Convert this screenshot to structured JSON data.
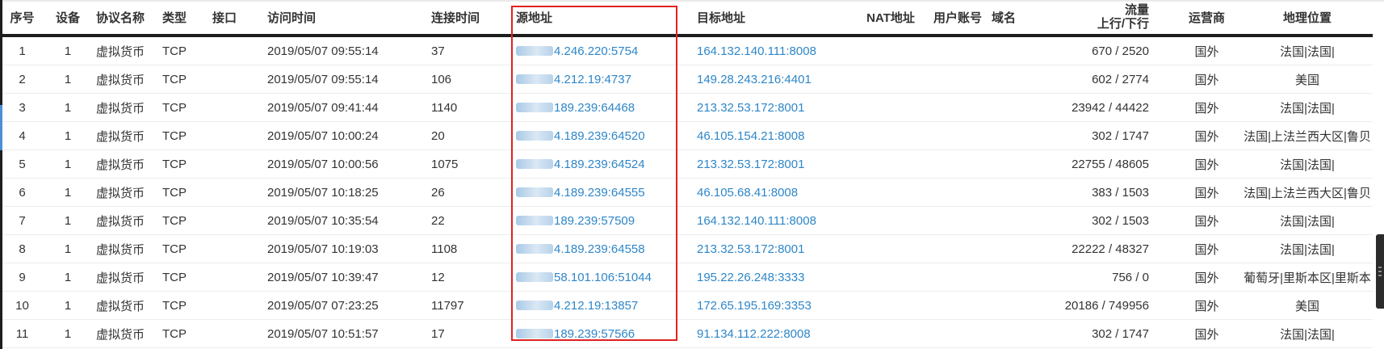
{
  "headers": {
    "seq": "序号",
    "device": "设备",
    "protocol": "协议名称",
    "type": "类型",
    "iface": "接口",
    "time": "访问时间",
    "duration": "连接时间",
    "src": "源地址",
    "dst": "目标地址",
    "nat": "NAT地址",
    "user": "用户账号",
    "domain": "域名",
    "flow_top": "流量",
    "flow_bottom": "上行/下行",
    "carrier": "运营商",
    "geo": "地理位置"
  },
  "rows": [
    {
      "seq": "1",
      "device": "1",
      "protocol": "虚拟货币",
      "type": "TCP",
      "iface": "",
      "time": "2019/05/07 09:55:14",
      "duration": "37",
      "src": "4.246.220:5754",
      "dst": "164.132.140.111:8008",
      "nat": "",
      "user": "",
      "domain": "",
      "flow": "670 / 2520",
      "carrier": "国外",
      "geo": "法国|法国|"
    },
    {
      "seq": "2",
      "device": "1",
      "protocol": "虚拟货币",
      "type": "TCP",
      "iface": "",
      "time": "2019/05/07 09:55:14",
      "duration": "106",
      "src": "4.212.19:4737",
      "dst": "149.28.243.216:4401",
      "nat": "",
      "user": "",
      "domain": "",
      "flow": "602 / 2774",
      "carrier": "国外",
      "geo": "美国"
    },
    {
      "seq": "3",
      "device": "1",
      "protocol": "虚拟货币",
      "type": "TCP",
      "iface": "",
      "time": "2019/05/07 09:41:44",
      "duration": "1140",
      "src": "189.239:64468",
      "dst": "213.32.53.172:8001",
      "nat": "",
      "user": "",
      "domain": "",
      "flow": "23942 / 44422",
      "carrier": "国外",
      "geo": "法国|法国|"
    },
    {
      "seq": "4",
      "device": "1",
      "protocol": "虚拟货币",
      "type": "TCP",
      "iface": "",
      "time": "2019/05/07 10:00:24",
      "duration": "20",
      "src": "4.189.239:64520",
      "dst": "46.105.154.21:8008",
      "nat": "",
      "user": "",
      "domain": "",
      "flow": "302 / 1747",
      "carrier": "国外",
      "geo": "法国|上法兰西大区|鲁贝"
    },
    {
      "seq": "5",
      "device": "1",
      "protocol": "虚拟货币",
      "type": "TCP",
      "iface": "",
      "time": "2019/05/07 10:00:56",
      "duration": "1075",
      "src": "4.189.239:64524",
      "dst": "213.32.53.172:8001",
      "nat": "",
      "user": "",
      "domain": "",
      "flow": "22755 / 48605",
      "carrier": "国外",
      "geo": "法国|法国|"
    },
    {
      "seq": "6",
      "device": "1",
      "protocol": "虚拟货币",
      "type": "TCP",
      "iface": "",
      "time": "2019/05/07 10:18:25",
      "duration": "26",
      "src": "4.189.239:64555",
      "dst": "46.105.68.41:8008",
      "nat": "",
      "user": "",
      "domain": "",
      "flow": "383 / 1503",
      "carrier": "国外",
      "geo": "法国|上法兰西大区|鲁贝"
    },
    {
      "seq": "7",
      "device": "1",
      "protocol": "虚拟货币",
      "type": "TCP",
      "iface": "",
      "time": "2019/05/07 10:35:54",
      "duration": "22",
      "src": "189.239:57509",
      "dst": "164.132.140.111:8008",
      "nat": "",
      "user": "",
      "domain": "",
      "flow": "302 / 1503",
      "carrier": "国外",
      "geo": "法国|法国|"
    },
    {
      "seq": "8",
      "device": "1",
      "protocol": "虚拟货币",
      "type": "TCP",
      "iface": "",
      "time": "2019/05/07 10:19:03",
      "duration": "1108",
      "src": "4.189.239:64558",
      "dst": "213.32.53.172:8001",
      "nat": "",
      "user": "",
      "domain": "",
      "flow": "22222 / 48327",
      "carrier": "国外",
      "geo": "法国|法国|"
    },
    {
      "seq": "9",
      "device": "1",
      "protocol": "虚拟货币",
      "type": "TCP",
      "iface": "",
      "time": "2019/05/07 10:39:47",
      "duration": "12",
      "src": "58.101.106:51044",
      "dst": "195.22.26.248:3333",
      "nat": "",
      "user": "",
      "domain": "",
      "flow": "756 / 0",
      "carrier": "国外",
      "geo": "葡萄牙|里斯本区|里斯本"
    },
    {
      "seq": "10",
      "device": "1",
      "protocol": "虚拟货币",
      "type": "TCP",
      "iface": "",
      "time": "2019/05/07 07:23:25",
      "duration": "11797",
      "src": "4.212.19:13857",
      "dst": "172.65.195.169:3353",
      "nat": "",
      "user": "",
      "domain": "",
      "flow": "20186 / 749956",
      "carrier": "国外",
      "geo": "美国"
    },
    {
      "seq": "11",
      "device": "1",
      "protocol": "虚拟货币",
      "type": "TCP",
      "iface": "",
      "time": "2019/05/07 10:51:57",
      "duration": "17",
      "src": "189.239:57566",
      "dst": "91.134.112.222:8008",
      "nat": "",
      "user": "",
      "domain": "",
      "flow": "302 / 1747",
      "carrier": "国外",
      "geo": "法国|法国|"
    }
  ],
  "colors": {
    "link": "#2e86c8",
    "highlight_box": "#e02222",
    "header_rule": "#1d1d1d"
  }
}
